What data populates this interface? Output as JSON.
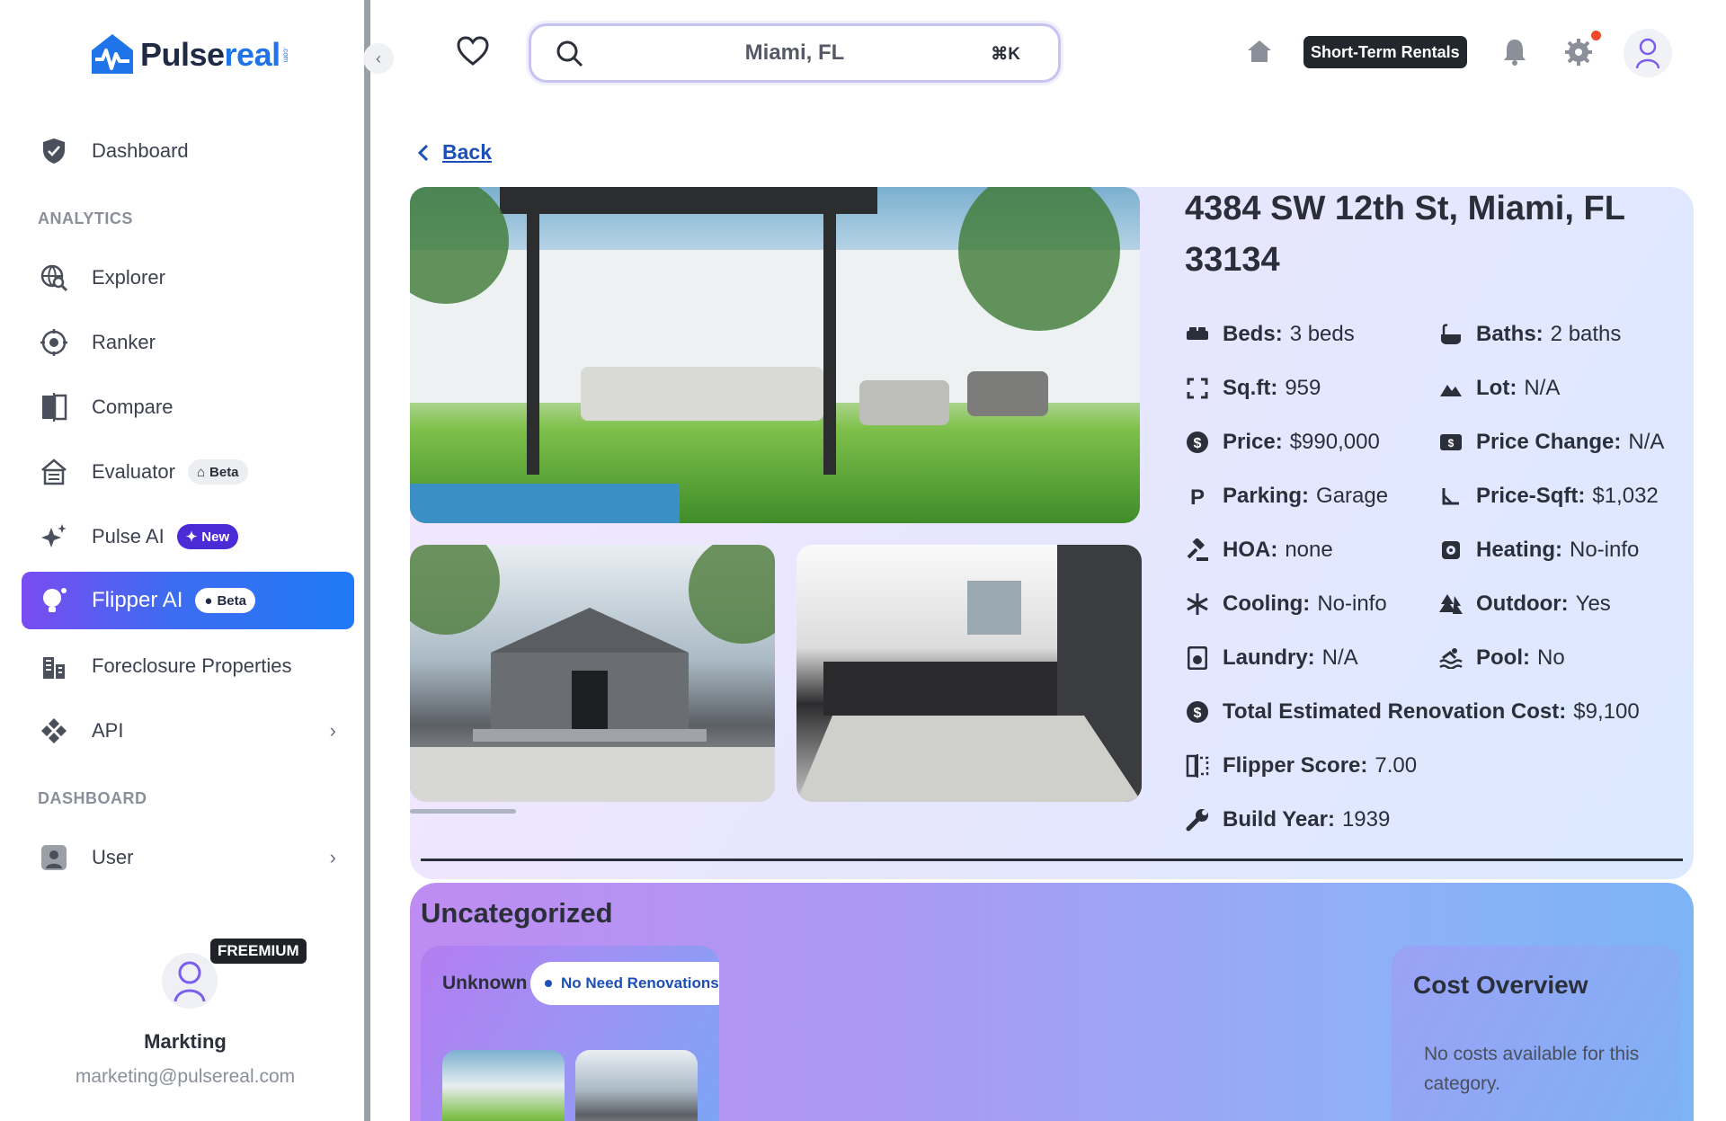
{
  "brand": {
    "name_part1": "Pulse",
    "name_part2": "real",
    "suffix": ".com"
  },
  "sidebar": {
    "items": [
      {
        "label": "Dashboard",
        "icon": "shield-icon"
      },
      {
        "label": "Explorer",
        "icon": "globe-search-icon"
      },
      {
        "label": "Ranker",
        "icon": "target-icon"
      },
      {
        "label": "Compare",
        "icon": "compare-icon"
      },
      {
        "label": "Evaluator",
        "icon": "house-eval-icon",
        "badge": "Beta"
      },
      {
        "label": "Pulse AI",
        "icon": "sparkles-icon",
        "badge": "New"
      },
      {
        "label": "Flipper AI",
        "icon": "lightbulb-icon",
        "badge": "Beta",
        "active": true
      },
      {
        "label": "Foreclosure Properties",
        "icon": "buildings-icon"
      },
      {
        "label": "API",
        "icon": "api-icon"
      },
      {
        "label": "User",
        "icon": "user-icon"
      }
    ],
    "sections": {
      "analytics": "ANALYTICS",
      "dashboard": "DASHBOARD"
    }
  },
  "profile": {
    "plan": "FREEMIUM",
    "name": "Markting",
    "email": "marketing@pulsereal.com"
  },
  "header": {
    "search_value": "Miami, FL",
    "shortcut": "⌘K",
    "rental_button": "Short-Term Rentals"
  },
  "back_label": "Back",
  "property": {
    "address": "4384 SW 12th St, Miami, FL 33134",
    "specs": {
      "beds": {
        "label": "Beds:",
        "value": "3 beds"
      },
      "baths": {
        "label": "Baths:",
        "value": "2 baths"
      },
      "sqft": {
        "label": "Sq.ft:",
        "value": "959"
      },
      "lot": {
        "label": "Lot:",
        "value": "N/A"
      },
      "price": {
        "label": "Price:",
        "value": "$990,000"
      },
      "price_change": {
        "label": "Price Change:",
        "value": "N/A"
      },
      "parking": {
        "label": "Parking:",
        "value": "Garage"
      },
      "price_sqft": {
        "label": "Price-Sqft:",
        "value": "$1,032"
      },
      "hoa": {
        "label": "HOA:",
        "value": "none"
      },
      "heating": {
        "label": "Heating:",
        "value": "No-info"
      },
      "cooling": {
        "label": "Cooling:",
        "value": "No-info"
      },
      "outdoor": {
        "label": "Outdoor:",
        "value": "Yes"
      },
      "laundry": {
        "label": "Laundry:",
        "value": "N/A"
      },
      "pool": {
        "label": "Pool:",
        "value": "No"
      },
      "renovation": {
        "label": "Total Estimated Renovation Cost:",
        "value": "$9,100"
      },
      "flipper": {
        "label": "Flipper Score:",
        "value": "7.00"
      },
      "build_year": {
        "label": "Build Year:",
        "value": "1939"
      }
    }
  },
  "category": {
    "title": "Uncategorized",
    "card_label": "Unknown",
    "pill": "No Need Renovations",
    "cost_title": "Cost Overview",
    "cost_text": "No costs available for this category."
  },
  "colors": {
    "accent": "#1e74e8",
    "active_nav_start": "#7a4cf0",
    "active_nav_end": "#1f7af5",
    "link": "#1c4fb8"
  }
}
